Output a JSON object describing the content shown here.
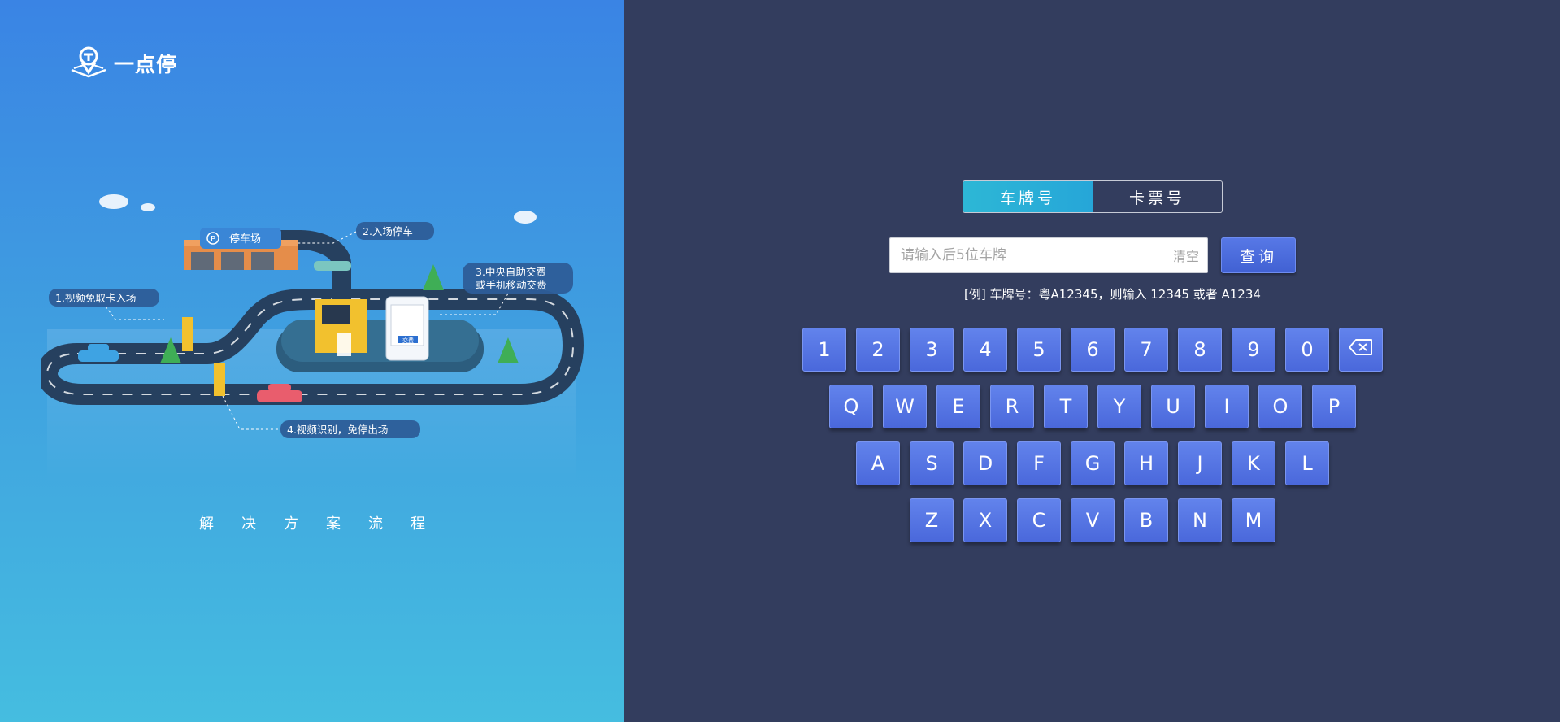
{
  "brand": {
    "name": "一点停",
    "icon": "parking-pin-logo-icon"
  },
  "illustration": {
    "labels": {
      "parking": "停车场",
      "step1": "1.视频免取卡入场",
      "step2": "2.入场停车",
      "step3a": "3.中央自助交费",
      "step3b": "或手机移动交费",
      "step4": "4.视频识别，免停出场",
      "pay": "交费"
    },
    "caption": "解决方案流程"
  },
  "tabs": [
    {
      "label": "车牌号",
      "active": true
    },
    {
      "label": "卡票号",
      "active": false
    }
  ],
  "search": {
    "placeholder": "请输入后5位车牌",
    "value": "",
    "clear_label": "清空",
    "query_label": "查询"
  },
  "hint": "[例] 车牌号：粤A12345，则输入 12345 或者 A1234",
  "keyboard": {
    "row1": [
      "1",
      "2",
      "3",
      "4",
      "5",
      "6",
      "7",
      "8",
      "9",
      "0"
    ],
    "backspace_icon": "backspace-icon",
    "row2": [
      "Q",
      "W",
      "E",
      "R",
      "T",
      "Y",
      "U",
      "I",
      "O",
      "P"
    ],
    "row3": [
      "A",
      "S",
      "D",
      "F",
      "G",
      "H",
      "J",
      "K",
      "L"
    ],
    "row4": [
      "Z",
      "X",
      "C",
      "V",
      "B",
      "N",
      "M"
    ]
  },
  "colors": {
    "left_panel_top": "#3a84e4",
    "left_panel_bottom": "#45bde0",
    "right_panel": "#333d5e",
    "tab_active": "#2db7d6",
    "key": "#5475e3"
  }
}
